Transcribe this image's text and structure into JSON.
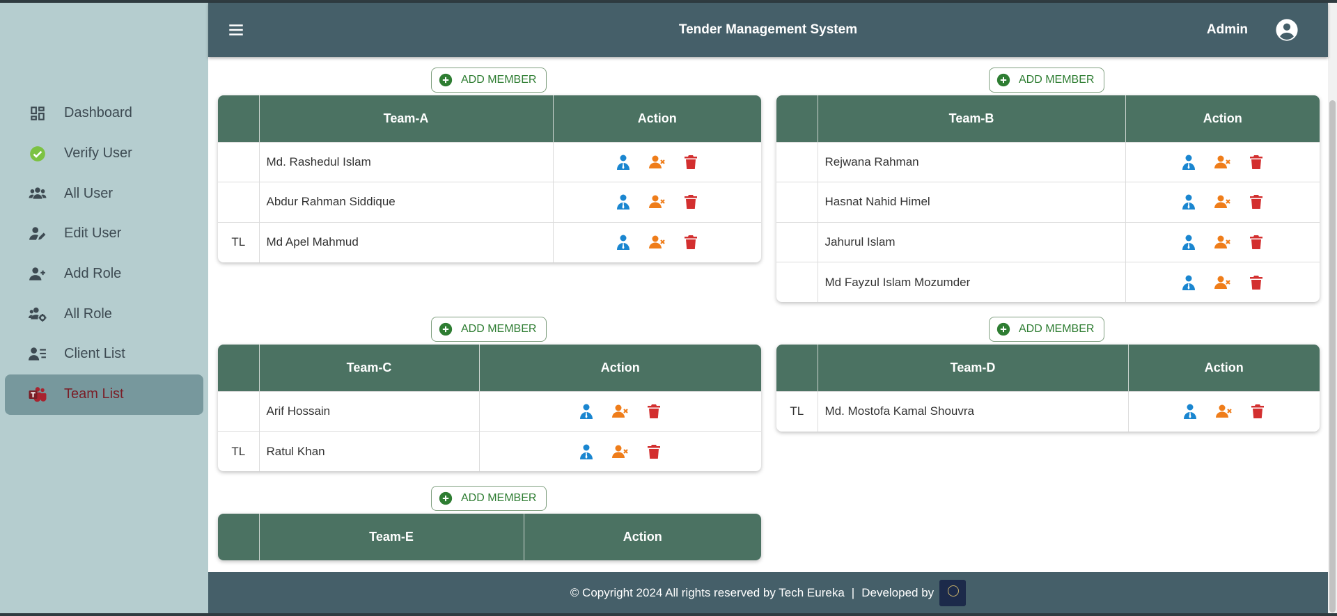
{
  "header": {
    "title": "Tender Management System",
    "admin_label": "Admin"
  },
  "sidebar": {
    "items": [
      {
        "label": "Dashboard",
        "icon": "dashboard-icon"
      },
      {
        "label": "Verify User",
        "icon": "verify-check-icon"
      },
      {
        "label": "All User",
        "icon": "users-icon"
      },
      {
        "label": "Edit User",
        "icon": "user-edit-icon"
      },
      {
        "label": "Add Role",
        "icon": "user-plus-icon"
      },
      {
        "label": "All Role",
        "icon": "users-gear-icon"
      },
      {
        "label": "Client List",
        "icon": "client-list-icon"
      },
      {
        "label": "Team List",
        "icon": "teams-icon",
        "active": true
      }
    ]
  },
  "content": {
    "add_member_label": "ADD MEMBER",
    "action_header": "Action",
    "teams": [
      {
        "name": "Team-A",
        "members": [
          {
            "role": "",
            "name": "Md. Rashedul Islam"
          },
          {
            "role": "",
            "name": "Abdur Rahman Siddique"
          },
          {
            "role": "TL",
            "name": "Md Apel Mahmud"
          }
        ]
      },
      {
        "name": "Team-B",
        "members": [
          {
            "role": "",
            "name": "Rejwana Rahman"
          },
          {
            "role": "",
            "name": "Hasnat Nahid Himel"
          },
          {
            "role": "",
            "name": "Jahurul Islam"
          },
          {
            "role": "",
            "name": "Md Fayzul Islam Mozumder"
          }
        ]
      },
      {
        "name": "Team-C",
        "members": [
          {
            "role": "",
            "name": "Arif Hossain"
          },
          {
            "role": "TL",
            "name": "Ratul Khan"
          }
        ]
      },
      {
        "name": "Team-D",
        "members": [
          {
            "role": "TL",
            "name": "Md. Mostofa Kamal Shouvra"
          }
        ]
      },
      {
        "name": "Team-E",
        "members": []
      }
    ]
  },
  "footer": {
    "copyright": "© Copyright 2024 All rights reserved by Tech Eureka",
    "separator": "|",
    "developed_by": "Developed by"
  },
  "colors": {
    "header_bg": "#455f69",
    "sidebar_bg": "#b5cdcf",
    "table_header_bg": "#4b7262",
    "view_icon": "#1a86d0",
    "remove_icon": "#ef7d1a",
    "delete_icon": "#d32f2f",
    "add_green": "#2e7d32",
    "active_item_text": "#7a1e27"
  }
}
